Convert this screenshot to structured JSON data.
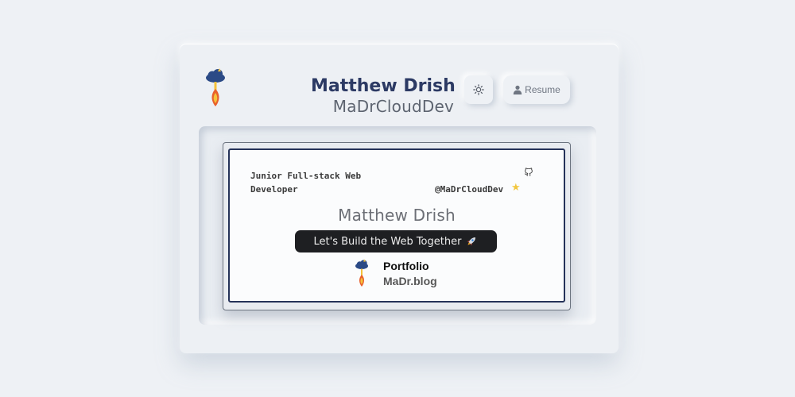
{
  "header": {
    "name": "Matthew Drish",
    "handle": "MaDrCloudDev",
    "theme_toggle_icon": "sun-icon",
    "resume_label": "Resume",
    "resume_icon": "user-icon"
  },
  "card": {
    "role": "Junior Full-stack Web Developer",
    "github_handle": "@MaDrCloudDev",
    "github_icon": "github-icon",
    "star_icon": "star-icon",
    "name": "Matthew Drish",
    "tagline": "Let's Build the Web Together",
    "tagline_icon": "rocket-icon",
    "portfolio_label": "Portfolio",
    "portfolio_url": "MaDr.blog"
  },
  "colors": {
    "background": "#eef1f5",
    "name_navy": "#2c3a64",
    "card_border": "#253259",
    "tagline_bg": "#1e1f22",
    "cloud_blue": "#2b4a86",
    "flame_orange": "#e8602c",
    "flame_yellow": "#f5c23a",
    "star_yellow": "#f2c740"
  }
}
